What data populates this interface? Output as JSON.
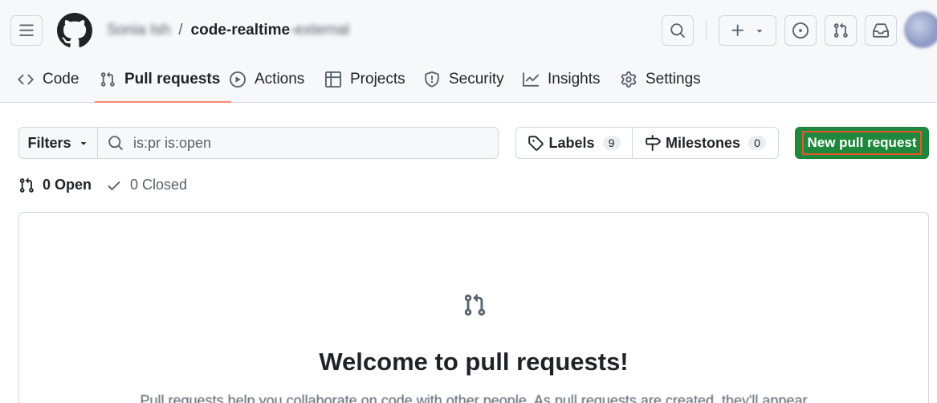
{
  "header": {
    "owner": "Sonia Ish",
    "separator": "/",
    "repo": "code-realtime",
    "repo_suffix": "-external",
    "icons": [
      "hamburger-icon",
      "github-logo-icon",
      "search-icon",
      "plus-icon",
      "triangle-down-icon",
      "issue-opened-icon",
      "git-pull-request-icon",
      "inbox-icon"
    ]
  },
  "tabs": [
    {
      "label": "Code",
      "icon": "code-icon"
    },
    {
      "label": "Pull requests",
      "icon": "git-pull-request-icon",
      "active": true
    },
    {
      "label": "Actions",
      "icon": "play-icon"
    },
    {
      "label": "Projects",
      "icon": "table-icon"
    },
    {
      "label": "Security",
      "icon": "shield-icon"
    },
    {
      "label": "Insights",
      "icon": "graph-icon"
    },
    {
      "label": "Settings",
      "icon": "gear-icon"
    }
  ],
  "toolbar": {
    "filters_label": "Filters",
    "search_value": "is:pr is:open",
    "labels_label": "Labels",
    "labels_count": "9",
    "milestones_label": "Milestones",
    "milestones_count": "0",
    "new_pr_label": "New pull request"
  },
  "state": {
    "open_label": "0 Open",
    "closed_label": "0 Closed"
  },
  "blankslate": {
    "title": "Welcome to pull requests!",
    "description": "Pull requests help you collaborate on code with other people. As pull requests are created, they'll appear"
  },
  "colors": {
    "accent_green": "#1f883d",
    "active_tab_underline": "#fd8c73",
    "highlight_border": "#e8572a"
  }
}
